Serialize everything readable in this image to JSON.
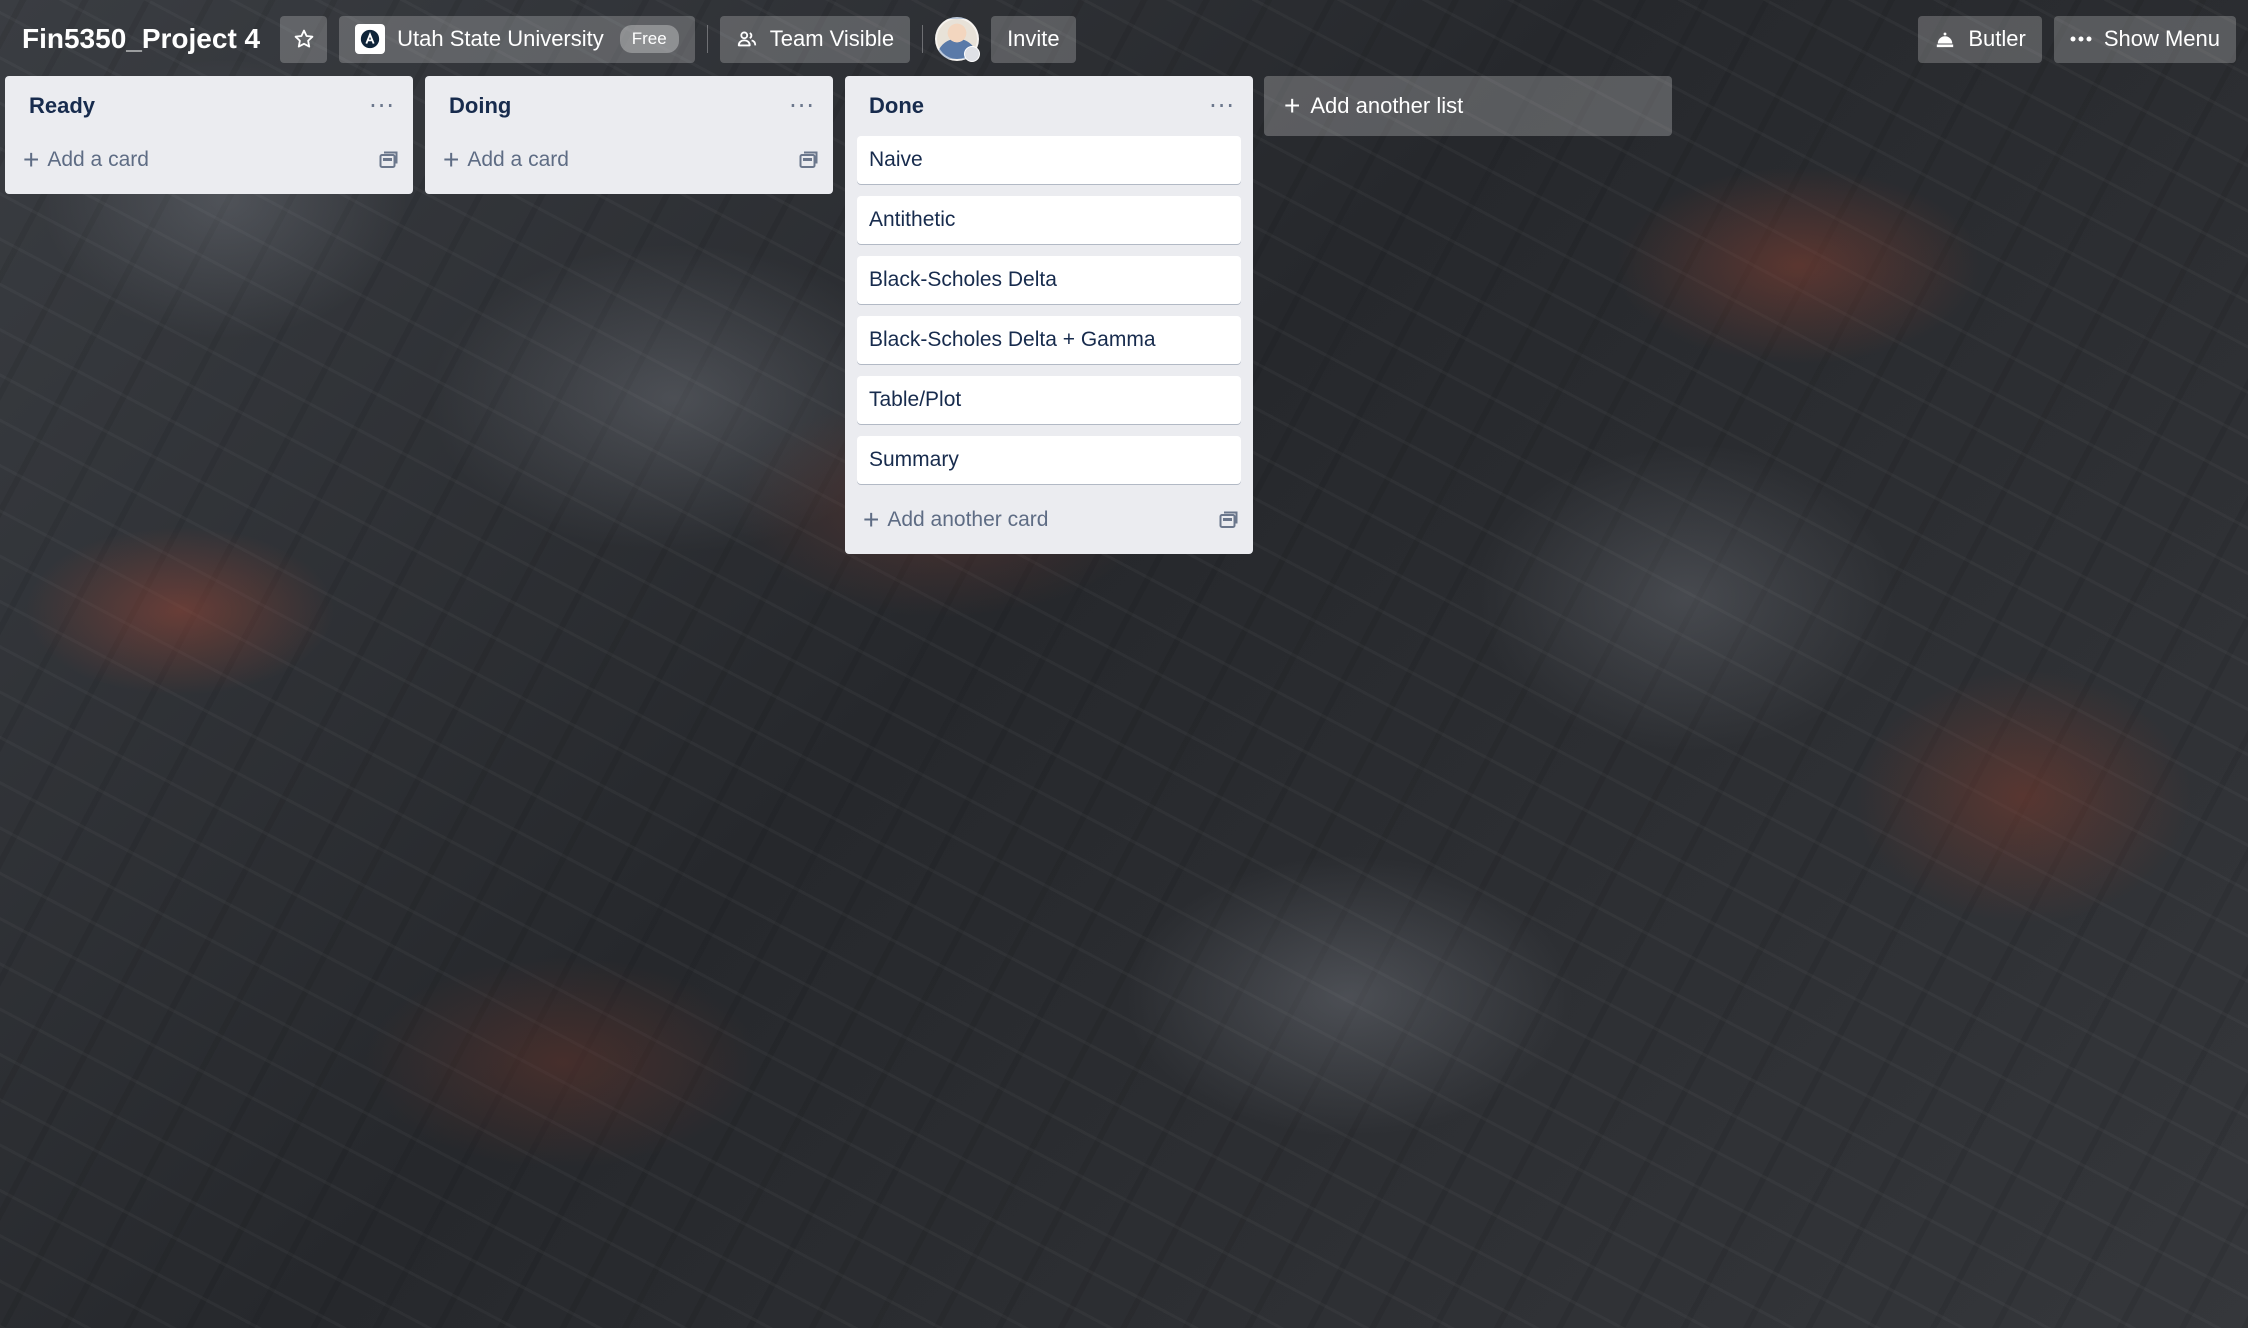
{
  "header": {
    "board_title": "Fin5350_Project 4",
    "star_icon": "star-icon",
    "workspace": {
      "name": "Utah State University",
      "badge": "Free",
      "icon": "org-logo-icon"
    },
    "visibility": {
      "label": "Team Visible",
      "icon": "team-visible-icon"
    },
    "invite_label": "Invite",
    "butler": {
      "label": "Butler",
      "icon": "butler-icon"
    },
    "menu": {
      "label": "Show Menu",
      "icon": "more-horizontal-icon"
    }
  },
  "lists": [
    {
      "title": "Ready",
      "cards": [],
      "add_label": "Add a card"
    },
    {
      "title": "Doing",
      "cards": [],
      "add_label": "Add a card"
    },
    {
      "title": "Done",
      "cards": [
        "Naive",
        "Antithetic",
        "Black-Scholes Delta",
        "Black-Scholes Delta + Gamma",
        "Table/Plot",
        "Summary"
      ],
      "add_label": "Add another card"
    }
  ],
  "add_list_label": "Add another list",
  "colors": {
    "list_bg": "#ebecf0",
    "card_bg": "#ffffff",
    "text": "#172b4d",
    "muted": "#5e6c84"
  }
}
